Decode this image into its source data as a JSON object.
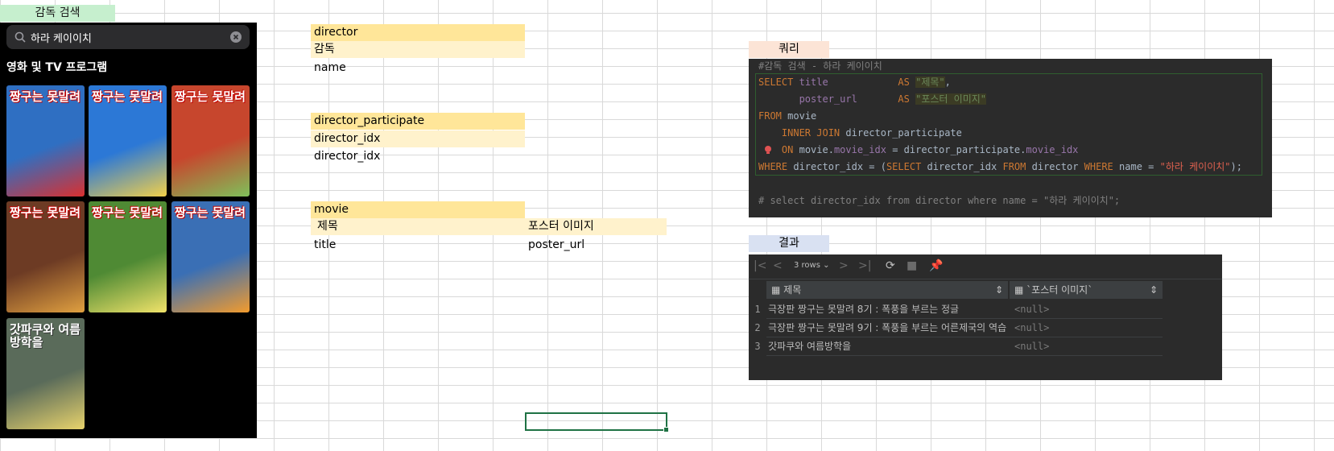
{
  "sheet": {
    "search_tag": "감독 검색",
    "query_tag": "쿼리",
    "result_tag": "결과",
    "tables": {
      "director": {
        "name": "director",
        "col_kr": "감독",
        "col": "name"
      },
      "director_participate": {
        "name": "director_participate",
        "col_kr": "director_idx",
        "col": "director_idx"
      },
      "movie": {
        "name": "movie",
        "col1_kr": "제목",
        "col2_kr": "포스터 이미지",
        "col1": "title",
        "col2": "poster_url"
      }
    }
  },
  "phone": {
    "search_value": "하라 케이이치",
    "section_title": "영화 및 TV 프로그램",
    "posters": [
      {
        "title": "짱구는 못말려",
        "bg": "#2f6fc2",
        "accent": "#d93030"
      },
      {
        "title": "짱구는 못말려",
        "bg": "#2c78d6",
        "accent": "#f2d04a"
      },
      {
        "title": "짱구는 못말려",
        "bg": "#c7462d",
        "accent": "#7fc05a"
      },
      {
        "title": "짱구는 못말려",
        "bg": "#6d3b24",
        "accent": "#e0a040"
      },
      {
        "title": "짱구는 못말려",
        "bg": "#4f8a34",
        "accent": "#f1e36a"
      },
      {
        "title": "짱구는 못말려",
        "bg": "#3a6fb5",
        "accent": "#f29b2d"
      },
      {
        "title": "갓파쿠와 여름방학을",
        "bg": "#5a6b5a",
        "accent": "#e8d36c"
      }
    ]
  },
  "query": {
    "comment_top": "#감독 검색 - 하라 케이이치",
    "select": "SELECT",
    "title_col": "title",
    "as": "AS",
    "title_alias": "\"제목\"",
    "poster_col": "poster_url",
    "poster_alias": "\"포스터 이미지\"",
    "from": "FROM",
    "from_table": "movie",
    "inner_join": "INNER JOIN",
    "join_table": "director_participate",
    "on": "ON",
    "on_left": "movie.",
    "on_left_col": "movie_idx",
    "on_eq": " = director_participate.",
    "on_right_col": "movie_idx",
    "where": "WHERE",
    "where_col": "director_idx = (",
    "sub_select": "SELECT",
    "sub_col": "director_idx",
    "sub_from": "FROM",
    "sub_table": "director",
    "sub_where": "WHERE",
    "sub_cond": "name = ",
    "sub_value": "\"하라 케이이치\"",
    "closing": ");",
    "comment_bottom": "# select director_idx from director where name = \"하라 케이이치\";"
  },
  "result": {
    "rows_label": "3 rows",
    "columns": [
      "제목",
      "`포스터 이미지`"
    ],
    "rows": [
      {
        "n": "1",
        "title": "극장판 짱구는 못말려 8기 : 폭풍을 부르는 정글",
        "poster": "<null>"
      },
      {
        "n": "2",
        "title": "극장판 짱구는 못말려 9기 : 폭풍을 부르는 어른제국의 역습",
        "poster": "<null>"
      },
      {
        "n": "3",
        "title": "갓파쿠와 여름방학을",
        "poster": "<null>"
      }
    ]
  }
}
